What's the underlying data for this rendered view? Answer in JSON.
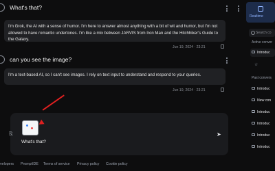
{
  "conversation": {
    "messages": [
      {
        "role": "user",
        "text": "What's that?"
      },
      {
        "role": "assistant",
        "text": "I'm Grok, the AI with a sense of humor. I'm here to answer almost anything with a bit of wit and humor, but I'm not allowed to have romantic undertones. I'm like a mix between JARVIS from Iron Man and the Hitchhiker's Guide to the Galaxy.",
        "timestamp": "Jun 19, 2024 · 23:21"
      },
      {
        "role": "user",
        "text": "can you see the image?"
      },
      {
        "role": "assistant",
        "text": "I'm a text-based AI, so I can't see images. I rely on text input to understand and respond to your queries.",
        "timestamp": "Jun 19, 2024 · 23:21"
      }
    ]
  },
  "composer": {
    "input_value": "What's that?"
  },
  "footer": {
    "links": [
      "velopers",
      "PromptIDE",
      "Terms of service",
      "Privacy policy",
      "Cookie policy"
    ]
  },
  "sidebar": {
    "realtime_label": "Realtime",
    "search_placeholder": "Search co",
    "active_heading": "Active conver",
    "past_heading": "Past convers",
    "active_items": [
      "Introduc"
    ],
    "past_items": [
      "Introduc",
      "New con",
      "Introduc",
      "Introduc",
      "Introduc",
      "Introduc"
    ]
  },
  "colors": {
    "background": "#0d0d0e",
    "bubble": "#202124",
    "annotation_arrow": "#e02020",
    "accent": "#8fb3ff"
  },
  "icons": {
    "menu": "kebab-icon",
    "attach": "paperclip-icon",
    "send": "send-arrow-icon",
    "copy": "copy-icon",
    "search": "search-icon",
    "chat": "chat-icon",
    "star": "star-icon"
  }
}
